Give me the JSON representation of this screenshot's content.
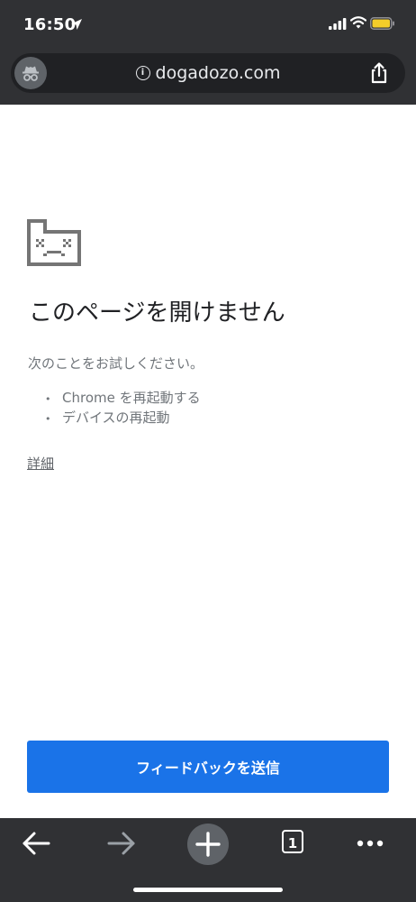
{
  "status": {
    "time": "16:50"
  },
  "omnibox": {
    "url": "dogadozo.com",
    "info_glyph": "i"
  },
  "error": {
    "title": "このページを開けません",
    "subtitle": "次のことをお試しください。",
    "suggestions": [
      "Chrome を再起動する",
      "デバイスの再起動"
    ],
    "details_label": "詳細"
  },
  "feedback_button": "フィードバックを送信",
  "toolbar": {
    "tab_count": "1"
  },
  "icons": [
    "location-arrow-icon",
    "cellular-signal-icon",
    "wifi-icon",
    "battery-icon",
    "incognito-icon",
    "info-icon",
    "share-icon",
    "sad-tab-icon",
    "back-arrow-icon",
    "forward-arrow-icon",
    "new-tab-plus-icon",
    "tab-switcher-icon",
    "more-menu-icon"
  ],
  "colors": {
    "chrome_dark": "#303134",
    "omnibox": "#202124",
    "button_blue": "#1a73e8",
    "battery_yellow": "#f4cd2a"
  }
}
